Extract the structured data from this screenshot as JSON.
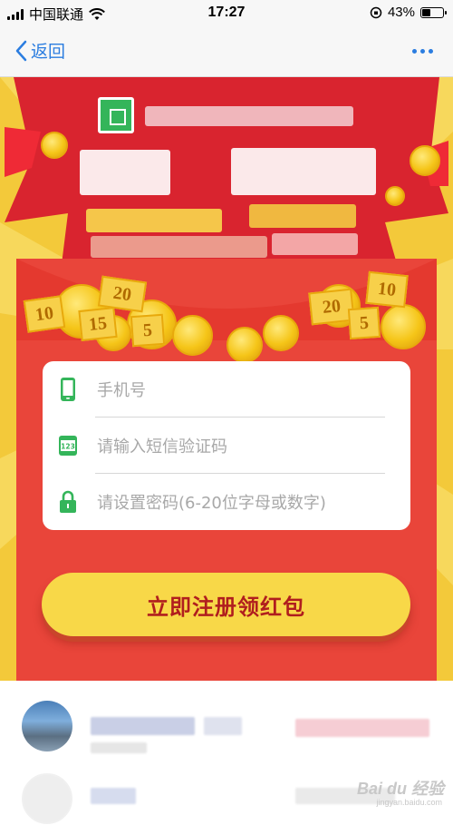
{
  "status_bar": {
    "carrier": "中国联通",
    "time": "17:27",
    "battery": "43%",
    "battery_level": 0.43
  },
  "nav": {
    "back_label": "返回"
  },
  "form": {
    "phone_placeholder": "手机号",
    "sms_placeholder": "请输入短信验证码",
    "password_placeholder": "请设置密码(6-20位字母或数字)",
    "sms_icon_text": "123"
  },
  "register_button": {
    "label": "立即注册领红包"
  },
  "tickets": [
    "10",
    "15",
    "20",
    "5",
    "20",
    "10",
    "5"
  ],
  "colors": {
    "accent_blue": "#2b7de0",
    "banner_yellow": "#f3c93a",
    "envelope_red": "#e9453a",
    "button_yellow": "#f8d848",
    "button_text": "#b01e1e",
    "icon_green": "#34b55a"
  },
  "watermark": {
    "text": "Bai du 经验",
    "sub": "jingyan.baidu.com"
  }
}
